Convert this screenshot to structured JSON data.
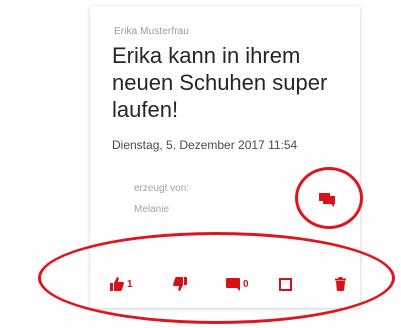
{
  "post": {
    "author": "Erika Musterfrau",
    "text": "Erika kann in ihrem neuen Schuhen super laufen!",
    "date": "Dienstag, 5. Dezember 2017 11:54",
    "created_label": "erzeugt von:",
    "created_by": "Melanie"
  },
  "actions": {
    "like_count": "1",
    "comment_count": "0",
    "icons": [
      "comment-icon",
      "thumbs-up-icon",
      "thumbs-down-icon",
      "comment-icon",
      "square-outline-icon",
      "trash-icon"
    ]
  },
  "colors": {
    "accent": "#d6111a",
    "annotation": "#e0141c",
    "text_primary": "#262626",
    "text_muted": "#a3a3a3"
  }
}
